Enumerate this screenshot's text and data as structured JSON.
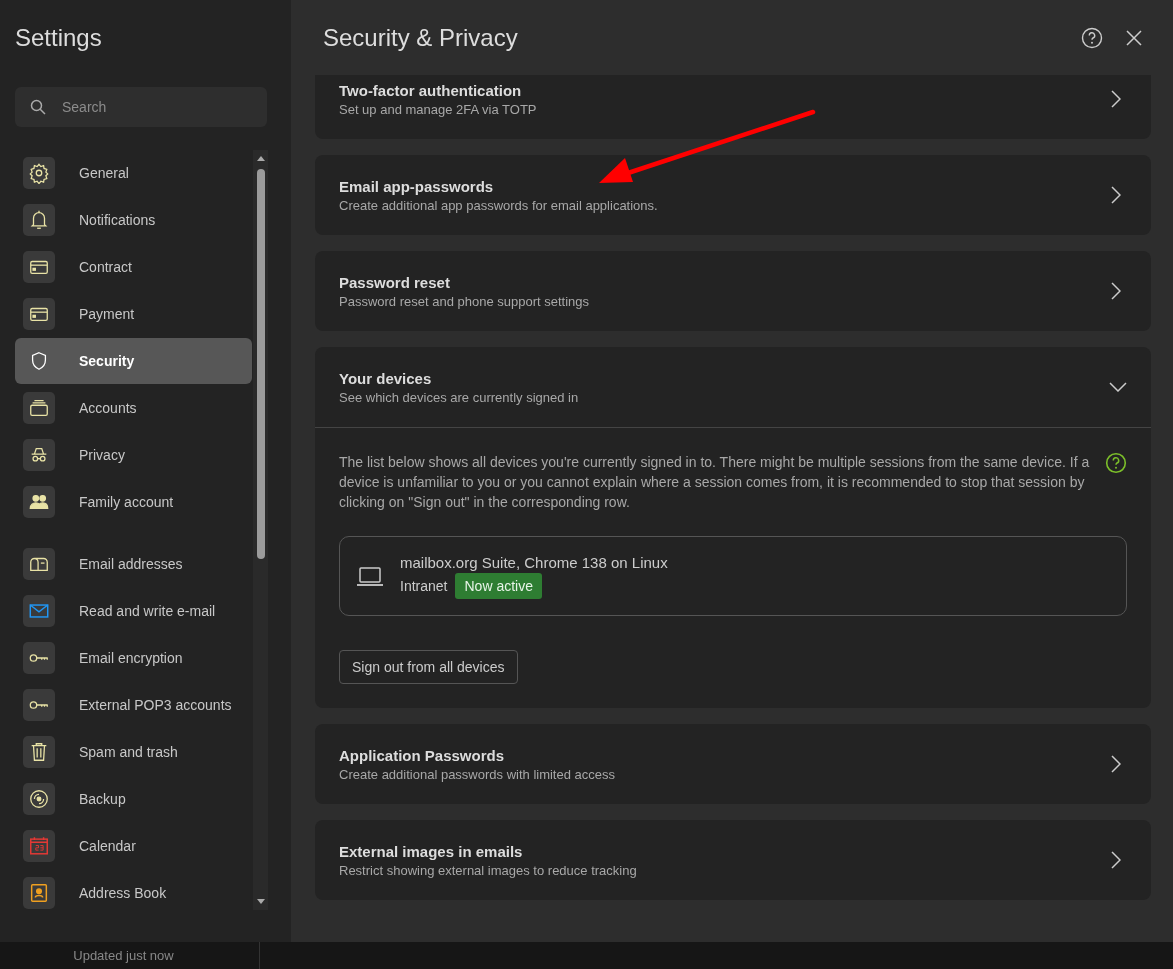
{
  "sidebar": {
    "title": "Settings",
    "search": {
      "placeholder": "Search"
    },
    "groups": [
      [
        {
          "label": "General",
          "selected": false
        },
        {
          "label": "Notifications",
          "selected": false
        },
        {
          "label": "Contract",
          "selected": false
        },
        {
          "label": "Payment",
          "selected": false
        },
        {
          "label": "Security",
          "selected": true
        },
        {
          "label": "Accounts",
          "selected": false
        },
        {
          "label": "Privacy",
          "selected": false
        },
        {
          "label": "Family account",
          "selected": false
        }
      ],
      [
        {
          "label": "Email addresses",
          "selected": false
        },
        {
          "label": "Read and write e-mail",
          "selected": false
        },
        {
          "label": "Email encryption",
          "selected": false
        },
        {
          "label": "External POP3 accounts",
          "selected": false
        },
        {
          "label": "Spam and trash",
          "selected": false
        },
        {
          "label": "Backup",
          "selected": false
        },
        {
          "label": "Calendar",
          "selected": false
        },
        {
          "label": "Address Book",
          "selected": false
        }
      ]
    ]
  },
  "main": {
    "title": "Security & Privacy",
    "sections": [
      {
        "kind": "link",
        "title": "Two-factor authentication",
        "subtitle": "Set up and manage 2FA via TOTP"
      },
      {
        "kind": "link",
        "title": "Email app-passwords",
        "subtitle": "Create additional app passwords for email applications."
      },
      {
        "kind": "link",
        "title": "Password reset",
        "subtitle": "Password reset and phone support settings"
      },
      {
        "kind": "panel",
        "title": "Your devices",
        "subtitle": "See which devices are currently signed in",
        "expanded": true,
        "description": "The list below shows all devices you're currently signed in to. There might be multiple sessions from the same device. If a device is unfamiliar to you or you cannot explain where a session comes from, it is recommended to stop that session by clicking on \"Sign out\" in the corresponding row.",
        "devices": [
          {
            "name": "mailbox.org Suite, Chrome 138 on Linux",
            "location": "Intranet",
            "badge": "Now active"
          }
        ],
        "button": "Sign out from all devices"
      },
      {
        "kind": "link",
        "title": "Application Passwords",
        "subtitle": "Create additional passwords with limited access"
      },
      {
        "kind": "link",
        "title": "External images in emails",
        "subtitle": "Restrict showing external images to reduce tracking"
      }
    ]
  },
  "status_bar": {
    "text": "Updated just now"
  }
}
